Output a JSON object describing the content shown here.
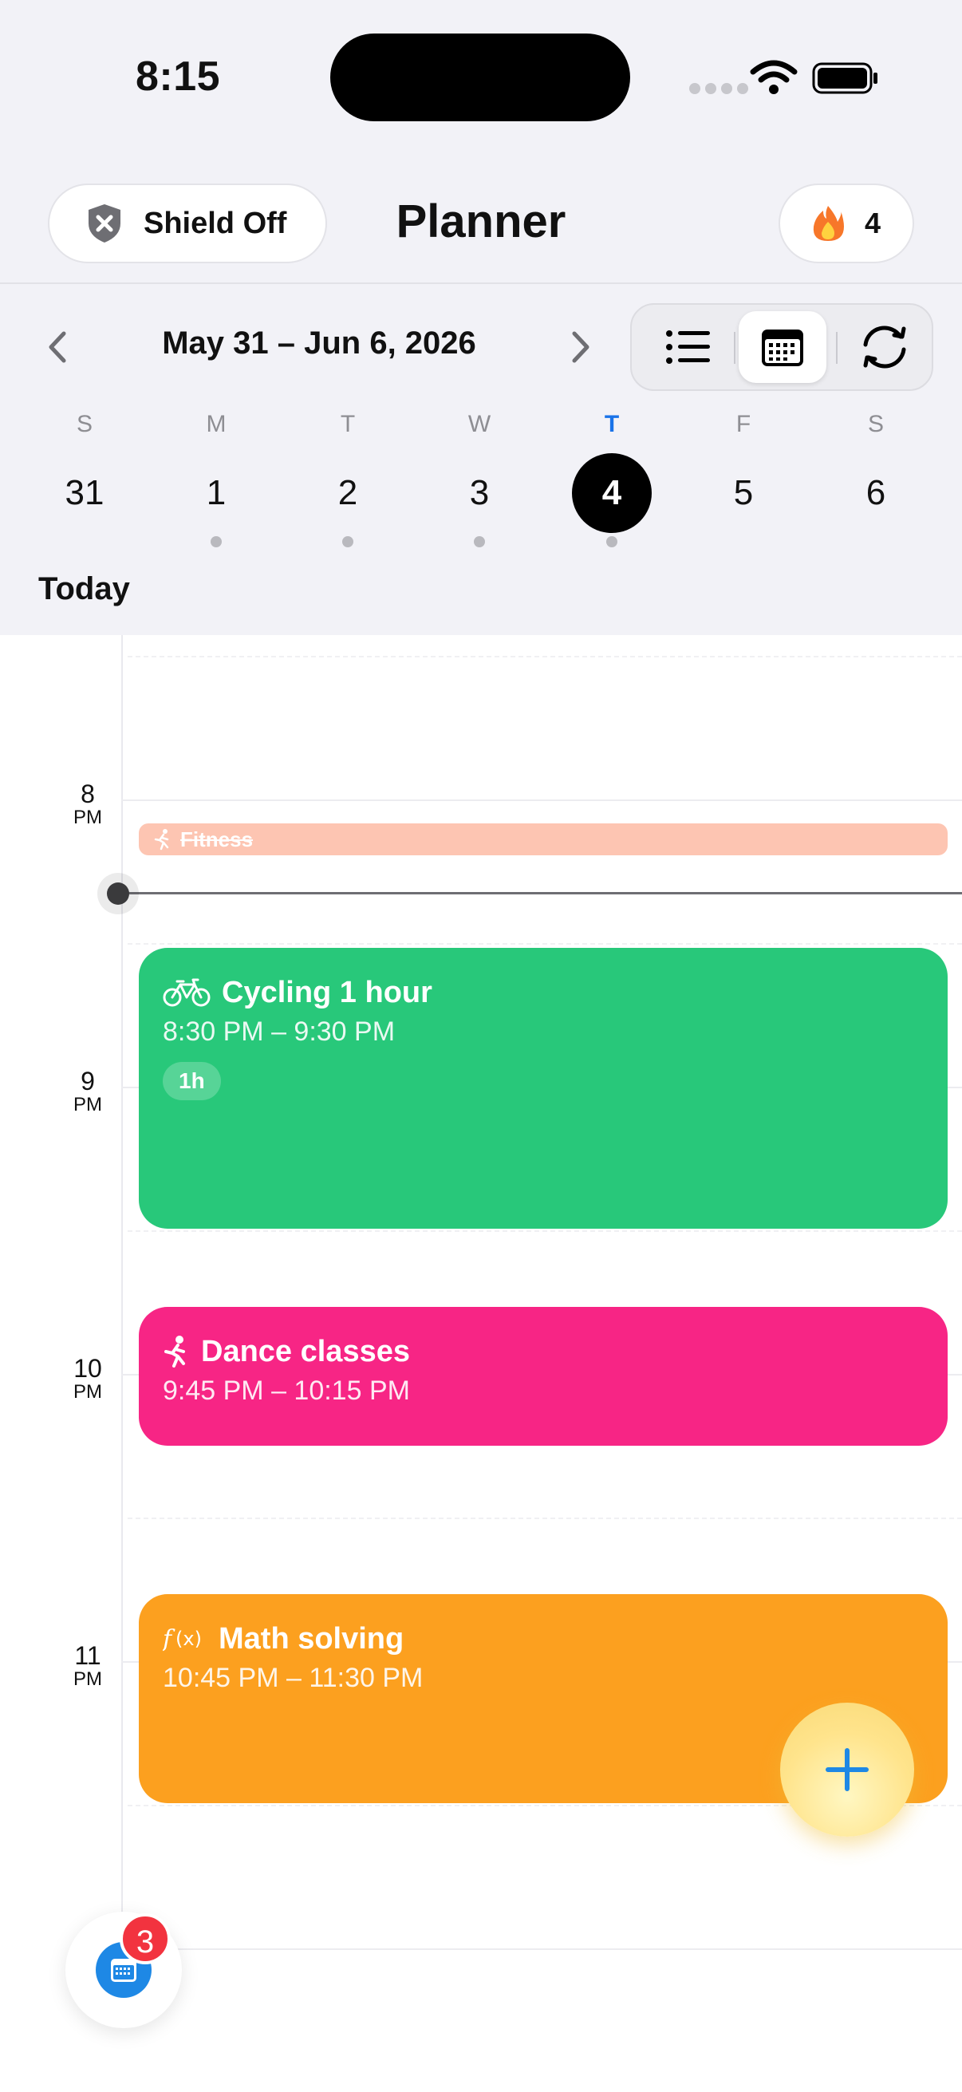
{
  "status_bar": {
    "time": "8:15"
  },
  "header": {
    "shield_label": "Shield Off",
    "title": "Planner",
    "streak_count": "4"
  },
  "week": {
    "range": "May 31 – Jun 6, 2026",
    "view_modes": [
      "list-icon",
      "calendar-icon",
      "sync-icon"
    ],
    "active_view": "calendar",
    "days": [
      {
        "name": "S",
        "num": "31",
        "has_events": false
      },
      {
        "name": "M",
        "num": "1",
        "has_events": true
      },
      {
        "name": "T",
        "num": "2",
        "has_events": true
      },
      {
        "name": "W",
        "num": "3",
        "has_events": true
      },
      {
        "name": "T",
        "num": "4",
        "has_events": true,
        "selected": true
      },
      {
        "name": "F",
        "num": "5",
        "has_events": false
      },
      {
        "name": "S",
        "num": "6",
        "has_events": false
      }
    ]
  },
  "today_label": "Today",
  "timeline": {
    "hours": [
      {
        "hour": "8",
        "meridiem": "PM"
      },
      {
        "hour": "9",
        "meridiem": "PM"
      },
      {
        "hour": "10",
        "meridiem": "PM"
      },
      {
        "hour": "11",
        "meridiem": "PM"
      }
    ],
    "events": {
      "fitness": {
        "title": "Fitness",
        "icon": "running-icon",
        "completed": true
      },
      "cycling": {
        "title": "Cycling 1 hour",
        "time": "8:30 PM – 9:30 PM",
        "badge": "1h",
        "icon": "bicycle-icon",
        "color": "#28c87a"
      },
      "dance": {
        "title": "Dance classes",
        "time": "9:45 PM – 10:15 PM",
        "icon": "running-icon",
        "color": "#f72585"
      },
      "math": {
        "title": "Math solving",
        "time": "10:45 PM – 11:30 PM",
        "icon": "function-icon",
        "color": "#fca01f"
      }
    }
  },
  "inbox": {
    "badge_count": "3"
  },
  "colors": {
    "accent": "#1a73e8",
    "fab": "#ffe48c",
    "badge": "#f2333f"
  }
}
